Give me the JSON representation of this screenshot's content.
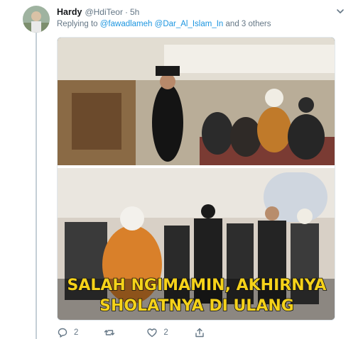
{
  "tweet": {
    "name": "Hardy",
    "handle": "@HdiTeor",
    "separator": "·",
    "time": "5h",
    "reply_prefix": "Replying to",
    "mentions": [
      "@fawadlameh",
      "@Dar_Al_Islam_In"
    ],
    "reply_suffix": "and 3 others"
  },
  "media": {
    "caption_line1": "SALAH NGIMAMIN, AKHIRNYA",
    "caption_line2": "SHOLATNYA DI ULANG"
  },
  "actions": {
    "reply_count": "2",
    "retweet_count": "",
    "like_count": "2"
  },
  "colors": {
    "accent": "#1b95e0",
    "muted": "#657786",
    "caption_fill": "#f5d21a",
    "caption_stroke": "#111111"
  }
}
